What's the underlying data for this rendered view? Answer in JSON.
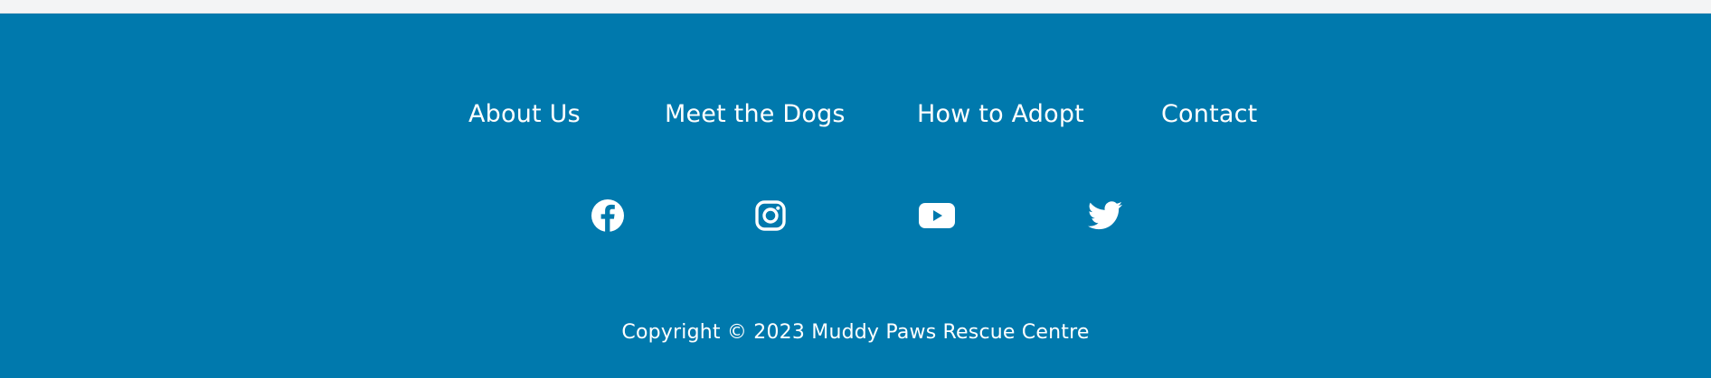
{
  "footer": {
    "background_color": "#0079ad",
    "text_color": "#ffffff",
    "nav": [
      {
        "label": "About Us"
      },
      {
        "label": "Meet the Dogs"
      },
      {
        "label": "How to Adopt"
      },
      {
        "label": "Contact"
      }
    ],
    "social": [
      {
        "icon": "facebook-icon",
        "label": "Facebook"
      },
      {
        "icon": "instagram-icon",
        "label": "Instagram"
      },
      {
        "icon": "youtube-icon",
        "label": "YouTube"
      },
      {
        "icon": "twitter-icon",
        "label": "Twitter"
      }
    ],
    "copyright": "Copyright © 2023 Muddy Paws Rescue Centre"
  }
}
